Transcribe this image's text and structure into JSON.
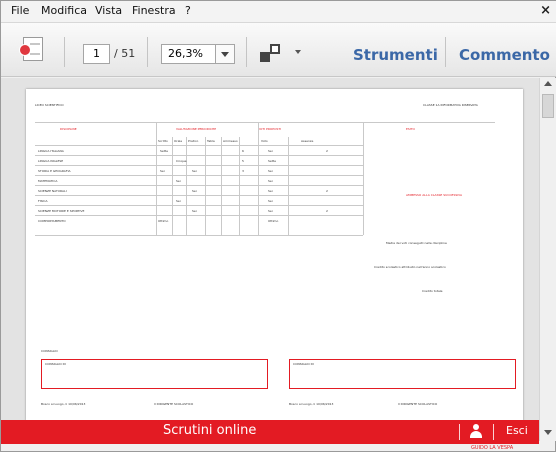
{
  "menu": {
    "items": [
      "File",
      "Modifica",
      "Vista",
      "Finestra",
      "?"
    ]
  },
  "toolbar": {
    "page_current": "1",
    "page_total": "/ 51",
    "zoom": "26,3%",
    "tools_label": "Strumenti",
    "comment_label": "Commento"
  },
  "document": {
    "header_left": "LICEO SCIENTIFICO",
    "header_right": "CLASSE 1A INFORMATIVA RISERVATA",
    "sections": {
      "left": "DISCIPLINE",
      "middle": "VALUTAZIONE PERIODICHE",
      "right1": "VOTI PROPOSTI",
      "right2": "ESITO"
    },
    "columns": [
      "Scritto",
      "Orale",
      "Pratico",
      "Tabla",
      "Ammesso",
      "Voto",
      "Assenze"
    ],
    "subjects": [
      "LINGUA ITALIANA",
      "LINGUA INGLESE",
      "STORIA E GEOGRAFIA",
      "MATEMATICA",
      "SCIENZE NATURALI",
      "FISICA",
      "SCIENZE MOTORIE E SPORTIVE",
      "COMPORTAMENTO"
    ],
    "subject_values": [
      [
        "Sette",
        "6",
        "Sei",
        "2"
      ],
      [
        "Cinque",
        "5",
        "Sette"
      ],
      [
        "Sei",
        "Sei",
        "3",
        "Sei"
      ],
      [
        "Sei",
        "Sei"
      ],
      [
        "Sei",
        "Sei",
        "2"
      ],
      [
        "Sei",
        "Sei"
      ],
      [
        "Sei",
        "Sei",
        "2"
      ],
      [
        "Ottimo",
        "Ottimo"
      ]
    ],
    "esito_label": "AMMESSO ALLA CLASSE SUCCESSIVA",
    "esito_lines": [
      "Media dei voti conseguiti nelle discipline",
      "Credito scolastico attribuito nell'anno scolastico",
      "Credito totale"
    ],
    "note_label": "CONSIGLIO",
    "signature_label_left": "Il DIRIGENTE SCOLASTICO",
    "signature_label_right": "Il DIRIGENTE SCOLASTICO",
    "box_left_label": "CONSIGLIO DI",
    "box_right_label": "CONSIGLIO DI",
    "place_left": "Bosco ai Luogo, li 10/06/2013",
    "place_right": "Bosco ai Luogo, li 10/06/2013"
  },
  "app_bar": {
    "title": "Scrutini online",
    "exit_label": "Esci",
    "footer": "GUIDO LA VESPA"
  },
  "colors": {
    "red": "#e31b23",
    "link": "#3b68a7"
  }
}
